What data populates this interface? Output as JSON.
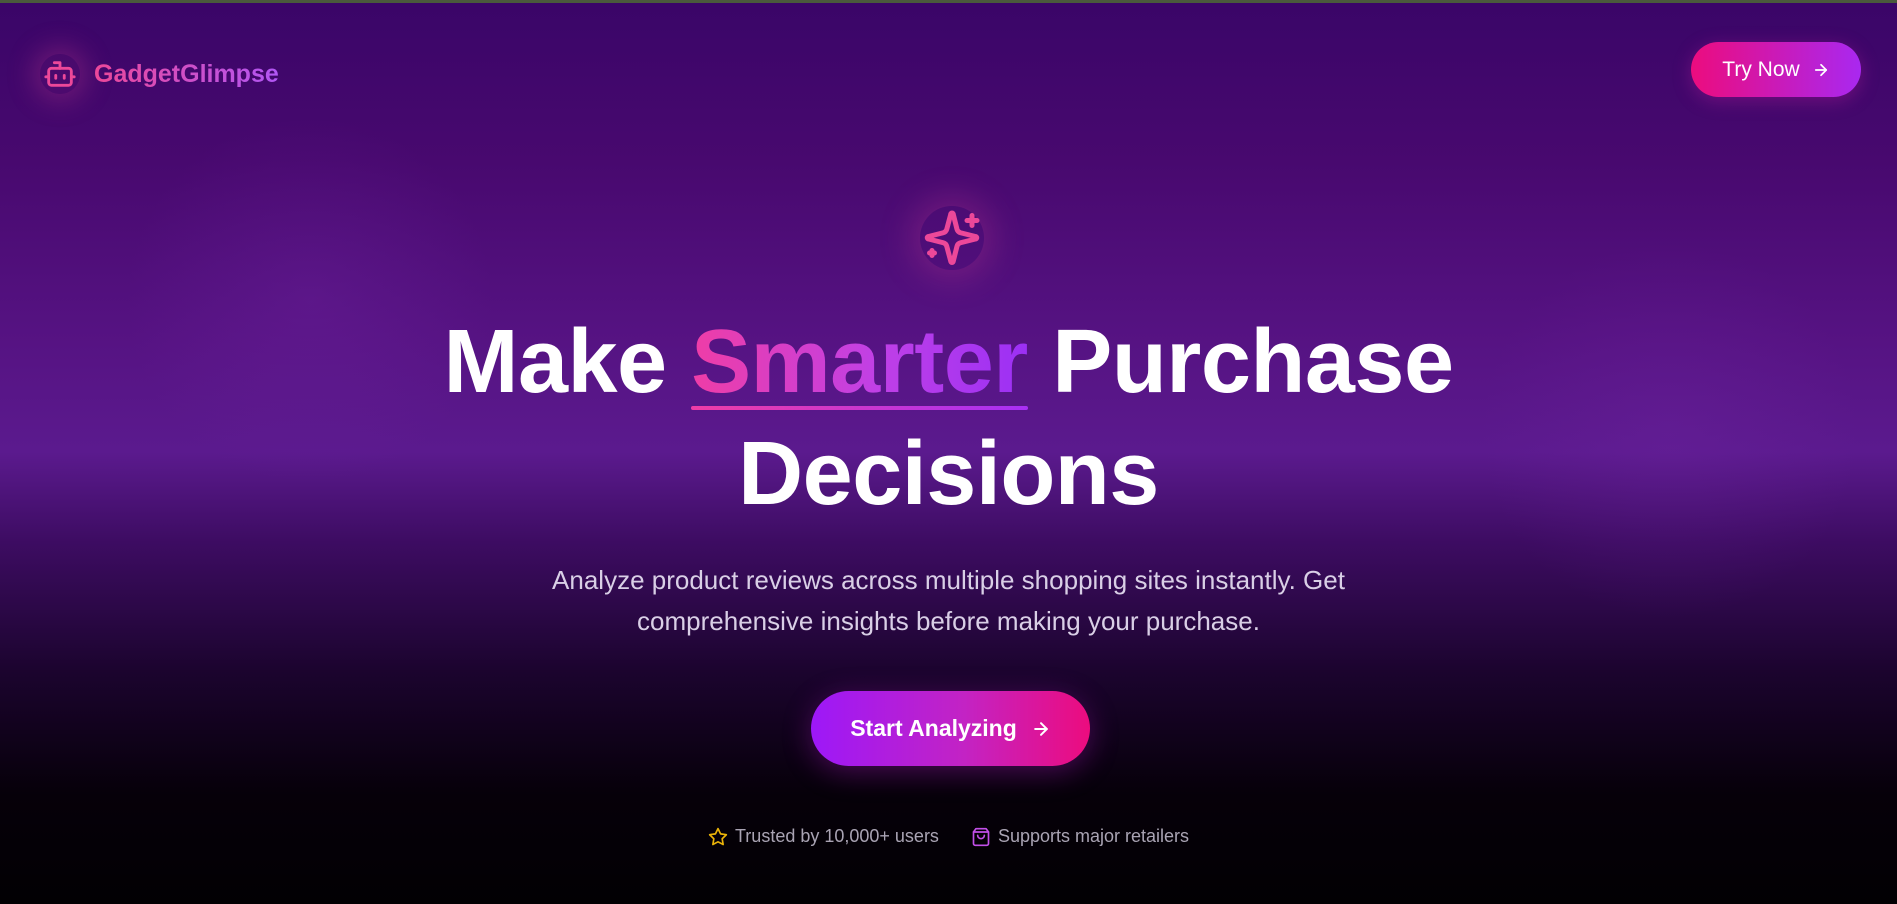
{
  "brand": {
    "name": "GadgetGlimpse",
    "icon": "robot-icon"
  },
  "header": {
    "cta_label": "Try Now",
    "cta_icon": "arrow-right-icon"
  },
  "hero": {
    "icon": "sparkles-icon",
    "headline_before": "Make ",
    "headline_accent": "Smarter",
    "headline_after": " Purchase Decisions",
    "subtitle": "Analyze product reviews across multiple shopping sites instantly. Get comprehensive insights before making your purchase.",
    "cta_label": "Start Analyzing",
    "cta_icon": "arrow-right-icon"
  },
  "trust": {
    "items": [
      {
        "icon": "star-icon",
        "label": "Trusted by 10,000+ users"
      },
      {
        "icon": "shopping-bag-icon",
        "label": "Supports major retailers"
      }
    ]
  },
  "colors": {
    "accent_pink": "#ec4899",
    "accent_purple": "#a855f7",
    "star_yellow": "#eab308"
  }
}
